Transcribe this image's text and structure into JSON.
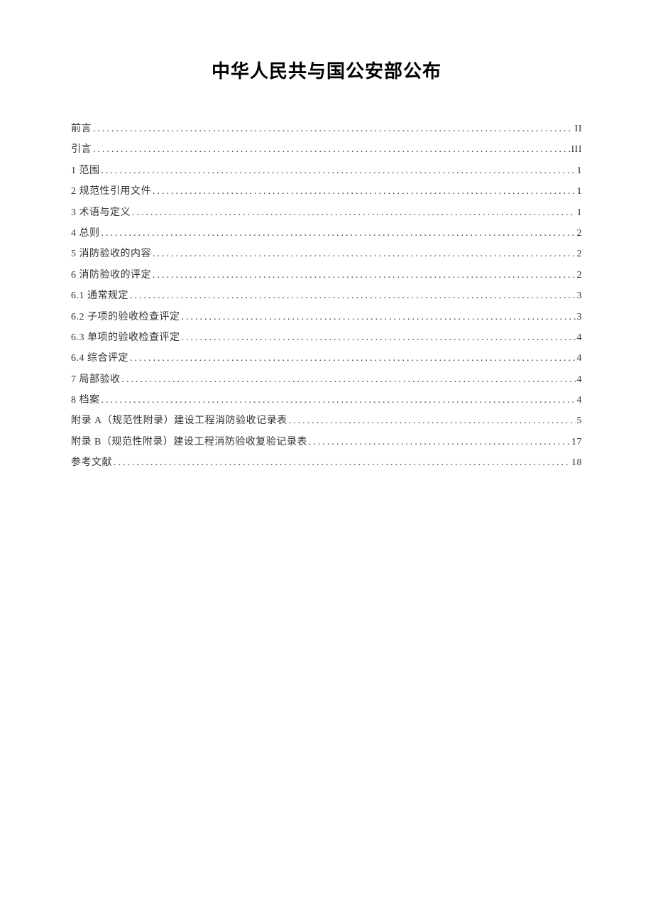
{
  "title": "中华人民共与国公安部公布",
  "toc": {
    "entries": [
      {
        "label": "前言",
        "page": "II"
      },
      {
        "label": "引言",
        "page": "III"
      },
      {
        "label": "1 范围",
        "page": "1"
      },
      {
        "label": "2 规范性引用文件",
        "page": "1"
      },
      {
        "label": "3 术语与定义",
        "page": "1"
      },
      {
        "label": "4 总则",
        "page": "2"
      },
      {
        "label": "5 消防验收的内容",
        "page": "2"
      },
      {
        "label": "6 消防验收的评定",
        "page": "2"
      },
      {
        "label": "6.1 通常规定",
        "page": "3"
      },
      {
        "label": "6.2 子项的验收检查评定",
        "page": "3"
      },
      {
        "label": "6.3 单项的验收检查评定",
        "page": "4"
      },
      {
        "label": "6.4 综合评定",
        "page": "4"
      },
      {
        "label": "7 局部验收",
        "page": "4"
      },
      {
        "label": "8 档案",
        "page": "4"
      },
      {
        "label": "附录 A（规范性附录）建设工程消防验收记录表",
        "page": "5"
      },
      {
        "label": "附录 B（规范性附录）建设工程消防验收复验记录表",
        "page": "17"
      },
      {
        "label": "参考文献",
        "page": "18"
      }
    ]
  }
}
